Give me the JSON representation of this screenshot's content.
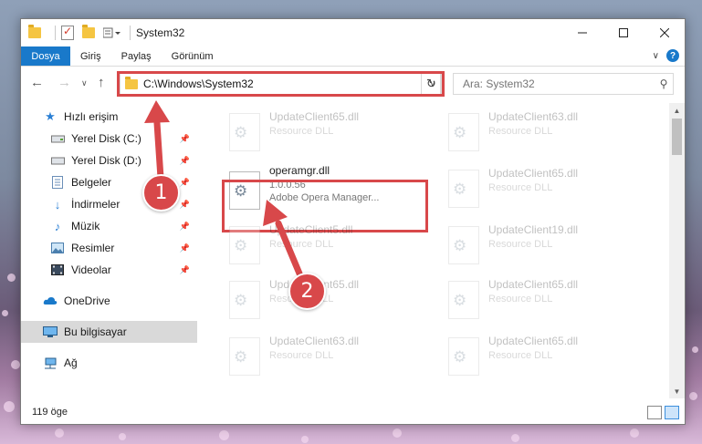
{
  "window": {
    "title": "System32"
  },
  "ribbon": {
    "tabs": [
      "Dosya",
      "Giriş",
      "Paylaş",
      "Görünüm"
    ]
  },
  "address": {
    "path": "C:\\Windows\\System32"
  },
  "search": {
    "placeholder": "Ara: System32"
  },
  "sidebar": {
    "items": [
      {
        "label": "Hızlı erişim",
        "icon": "star-icon"
      },
      {
        "label": "Yerel Disk (C:)",
        "icon": "drive-icon"
      },
      {
        "label": "Yerel Disk (D:)",
        "icon": "drive-icon"
      },
      {
        "label": "Belgeler",
        "icon": "documents-icon"
      },
      {
        "label": "İndirmeler",
        "icon": "download-icon"
      },
      {
        "label": "Müzik",
        "icon": "music-icon"
      },
      {
        "label": "Resimler",
        "icon": "pictures-icon"
      },
      {
        "label": "Videolar",
        "icon": "video-icon"
      },
      {
        "label": "OneDrive",
        "icon": "cloud-icon"
      },
      {
        "label": "Bu bilgisayar",
        "icon": "computer-icon"
      },
      {
        "label": "Ağ",
        "icon": "network-icon"
      }
    ]
  },
  "files": {
    "left": [
      {
        "name": "UpdateClient65.dll",
        "type": "Resource DLL"
      },
      {
        "name": "operamgr.dll",
        "version": "1.0.0.56",
        "description": "Adobe Opera Manager..."
      },
      {
        "name": "UpdateClient5.dll",
        "type": "Resource DLL"
      },
      {
        "name": "UpdateClient65.dll",
        "type": "Resource DLL"
      },
      {
        "name": "UpdateClient63.dll",
        "type": "Resource DLL"
      }
    ],
    "right": [
      {
        "name": "UpdateClient63.dll",
        "type": "Resource DLL"
      },
      {
        "name": "UpdateClient65.dll",
        "type": "Resource DLL"
      },
      {
        "name": "UpdateClient19.dll",
        "type": "Resource DLL"
      },
      {
        "name": "UpdateClient65.dll",
        "type": "Resource DLL"
      },
      {
        "name": "UpdateClient65.dll",
        "type": "Resource DLL"
      }
    ]
  },
  "status": {
    "item_count": "119 öge"
  },
  "annotations": {
    "step1": "1",
    "step2": "2"
  },
  "colors": {
    "accent": "#1979ca",
    "highlight": "#d8484a"
  }
}
